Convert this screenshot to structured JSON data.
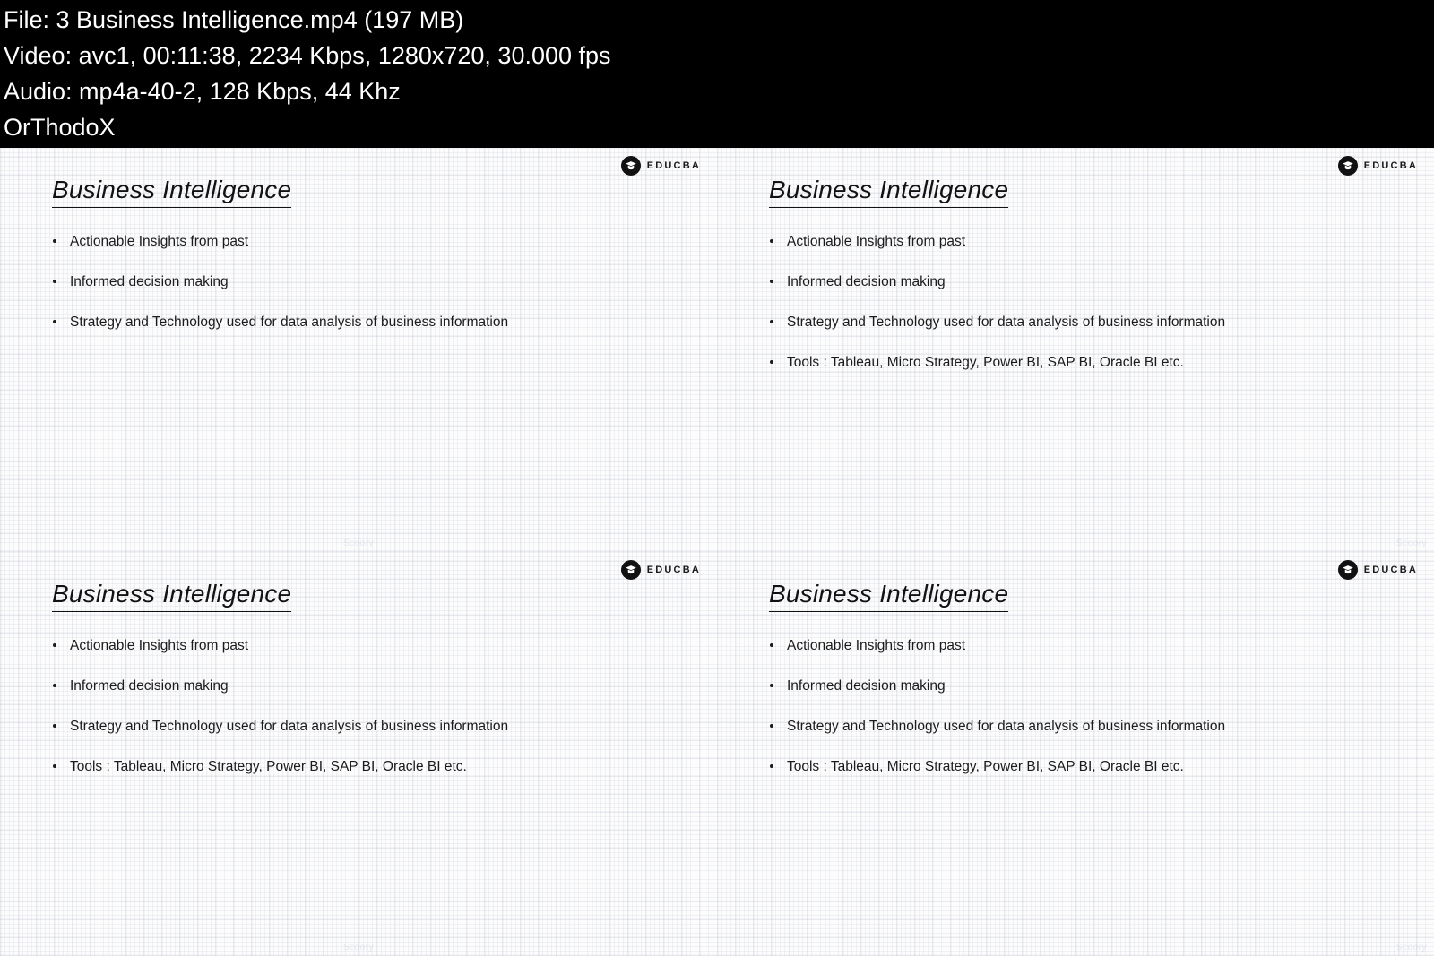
{
  "header": {
    "lines": [
      "File: 3  Business Intelligence.mp4 (197 MB)",
      "Video: avc1, 00:11:38, 2234 Kbps, 1280x720, 30.000 fps",
      "Audio: mp4a-40-2, 128 Kbps, 44 Khz",
      "OrThodoX"
    ],
    "file_label": "File: 3  Business Intelligence.mp4 (197 MB)",
    "video_label": "Video: avc1, 00:11:38, 2234 Kbps, 1280x720, 30.000 fps",
    "audio_label": "Audio: mp4a-40-2, 128 Kbps, 44 Khz",
    "release_label": "OrThodoX",
    "background_color": "#000000",
    "text_color": "#ffffff"
  },
  "brand": {
    "name": "EDUCBA",
    "mark_icon": "graduation-cap-icon",
    "mark_color": "#111111"
  },
  "slides": [
    {
      "title": "Business Intelligence",
      "bullets": [
        "Actionable Insights from past",
        "Informed decision making",
        "Strategy and Technology used for data analysis of business information"
      ],
      "watermark": "Scoory"
    },
    {
      "title": "Business Intelligence",
      "bullets": [
        "Actionable Insights from past",
        "Informed decision making",
        "Strategy and Technology used for data analysis of business information",
        "Tools : Tableau, Micro Strategy, Power BI, SAP BI, Oracle BI etc."
      ],
      "watermark": "Scoory"
    },
    {
      "title": "Business Intelligence",
      "bullets": [
        "Actionable Insights from past",
        "Informed decision making",
        "Strategy and Technology used for data analysis of business information",
        "Tools : Tableau, Micro Strategy, Power BI, SAP BI, Oracle BI etc."
      ],
      "watermark": "Scoory"
    },
    {
      "title": "Business Intelligence",
      "bullets": [
        "Actionable Insights from past",
        "Informed decision making",
        "Strategy and Technology used for data analysis of business information",
        "Tools : Tableau, Micro Strategy, Power BI, SAP BI, Oracle BI etc."
      ],
      "watermark": "Scoory"
    }
  ],
  "theme": {
    "slide_background": "#fcfcfd",
    "text_color": "#1b1b1b",
    "title_color": "#121212"
  }
}
